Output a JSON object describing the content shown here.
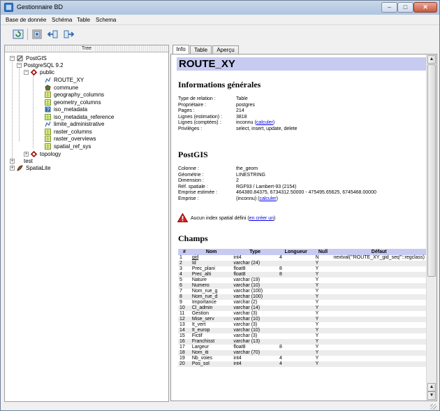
{
  "window": {
    "title": "Gestionnaire BD",
    "controls": [
      "minimize-icon",
      "maximize-icon",
      "close-icon"
    ]
  },
  "menu": [
    "Base de donnée",
    "Schéma",
    "Table",
    "Schema"
  ],
  "toolbar": {
    "icons": [
      "refresh-icon",
      "sql-window-icon",
      "import-icon",
      "export-icon"
    ]
  },
  "tree": {
    "header": "Tree",
    "nodes": [
      {
        "label": "PostGIS",
        "icon": "postgis-icon"
      },
      {
        "label": "PostgreSQL 9.2",
        "icon": "database-connection-icon"
      },
      {
        "label": "public",
        "icon": "schema-icon"
      },
      {
        "label": "ROUTE_XY",
        "icon": "line-layer-icon"
      },
      {
        "label": "commune",
        "icon": "polygon-layer-icon"
      },
      {
        "label": "geography_columns",
        "icon": "table-icon"
      },
      {
        "label": "geometry_columns",
        "icon": "table-icon"
      },
      {
        "label": "iso_metadata",
        "icon": "unknown-geometry-icon"
      },
      {
        "label": "iso_metadata_reference",
        "icon": "table-icon"
      },
      {
        "label": "limite_administrative",
        "icon": "line-layer-icon"
      },
      {
        "label": "raster_columns",
        "icon": "table-icon"
      },
      {
        "label": "raster_overviews",
        "icon": "table-icon"
      },
      {
        "label": "spatial_ref_sys",
        "icon": "table-icon"
      },
      {
        "label": "topology",
        "icon": "schema-icon"
      },
      {
        "label": "test",
        "icon": ""
      },
      {
        "label": "SpatiaLite",
        "icon": "spatialite-icon"
      }
    ]
  },
  "tabs": [
    {
      "label": "Info",
      "active": true
    },
    {
      "label": "Table",
      "active": false
    },
    {
      "label": "Aperçu",
      "active": false
    }
  ],
  "info": {
    "table_name": "ROUTE_XY",
    "general_title": "Informations générales",
    "general": [
      {
        "key": "Type de relation :",
        "value": "Table"
      },
      {
        "key": "Propriétaire :",
        "value": "postgres"
      },
      {
        "key": "Pages :",
        "value": "214"
      },
      {
        "key": "Lignes (estimation) :",
        "value": "3818"
      },
      {
        "key": "Lignes (comptées) :",
        "value": "inconnu (",
        "link": "calculer",
        "suffix": ")"
      },
      {
        "key": "Privilèges :",
        "value": "select, insert, update, delete"
      }
    ],
    "postgis_title": "PostGIS",
    "postgis": [
      {
        "key": "Colonne :",
        "value": "the_geom"
      },
      {
        "key": "Géométrie :",
        "value": "LINESTRING"
      },
      {
        "key": "Dimension :",
        "value": "2"
      },
      {
        "key": "Réf. spatiale :",
        "value": "RGF93 / Lambert-93 (2154)"
      },
      {
        "key": "Emprise estimée :",
        "value": "464380.84375, 6734312.50000 - 475495.65625, 6745468.00000"
      },
      {
        "key": "Emprise :",
        "value": "(inconnu) (",
        "link": "calculer",
        "suffix": ")"
      }
    ],
    "warning_text": "Aucun index spatial défini (",
    "warning_link": "en créer un",
    "warning_suffix": ")",
    "warning_icon": "warning-triangle-icon",
    "champs_title": "Champs",
    "columns": [
      "#",
      "Nom",
      "Type",
      "Longueur",
      "Null",
      "Défaut"
    ],
    "rows": [
      [
        "1",
        "gid",
        "int4",
        "4",
        "N",
        "nextval('\"ROUTE_XY_gid_seq\"'::regclass)"
      ],
      [
        "2",
        "Id",
        "varchar (24)",
        "",
        "Y",
        ""
      ],
      [
        "3",
        "Prec_plani",
        "float8",
        "8",
        "Y",
        ""
      ],
      [
        "4",
        "Prec_alti",
        "float8",
        "8",
        "Y",
        ""
      ],
      [
        "5",
        "Nature",
        "varchar (19)",
        "",
        "Y",
        ""
      ],
      [
        "6",
        "Numero",
        "varchar (10)",
        "",
        "Y",
        ""
      ],
      [
        "7",
        "Nom_rue_g",
        "varchar (100)",
        "",
        "Y",
        ""
      ],
      [
        "8",
        "Nom_rue_d",
        "varchar (100)",
        "",
        "Y",
        ""
      ],
      [
        "9",
        "Importance",
        "varchar (2)",
        "",
        "Y",
        ""
      ],
      [
        "10",
        "Cl_admin",
        "varchar (14)",
        "",
        "Y",
        ""
      ],
      [
        "11",
        "Gestion",
        "varchar (3)",
        "",
        "Y",
        ""
      ],
      [
        "12",
        "Mise_serv",
        "varchar (10)",
        "",
        "Y",
        ""
      ],
      [
        "13",
        "It_vert",
        "varchar (3)",
        "",
        "Y",
        ""
      ],
      [
        "14",
        "It_europ",
        "varchar (10)",
        "",
        "Y",
        ""
      ],
      [
        "15",
        "Fictif",
        "varchar (3)",
        "",
        "Y",
        ""
      ],
      [
        "16",
        "Franchisst",
        "varchar (13)",
        "",
        "Y",
        ""
      ],
      [
        "17",
        "Largeur",
        "float8",
        "8",
        "Y",
        ""
      ],
      [
        "18",
        "Nom_iti",
        "varchar (70)",
        "",
        "Y",
        ""
      ],
      [
        "19",
        "Nb_voies",
        "int4",
        "4",
        "Y",
        ""
      ],
      [
        "20",
        "Pos_sol",
        "int4",
        "4",
        "Y",
        ""
      ]
    ]
  },
  "colors": {
    "heading_bar": "#c7cbf2",
    "link": "#0000ee",
    "warning": "#d42020"
  }
}
